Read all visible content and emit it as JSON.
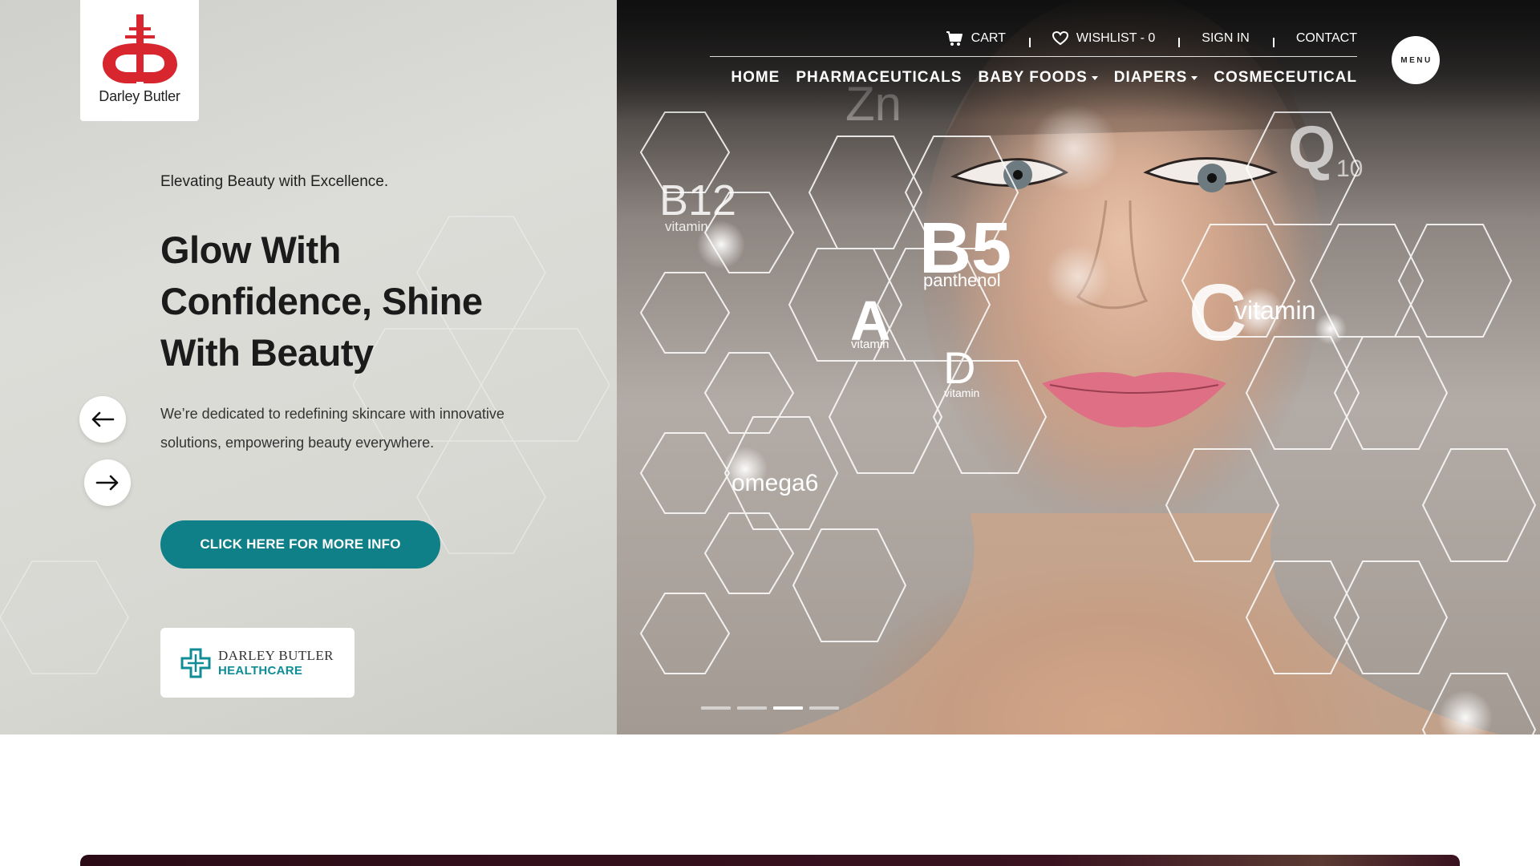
{
  "brand": {
    "name": "Darley Butler",
    "logo_color": "#d8262e"
  },
  "topbar": {
    "cart_label": "CART",
    "wishlist_label": "WISHLIST - 0",
    "signin_label": "SIGN IN",
    "contact_label": "CONTACT"
  },
  "nav": {
    "items": [
      {
        "label": "HOME",
        "dropdown": false
      },
      {
        "label": "PHARMACEUTICALS",
        "dropdown": false
      },
      {
        "label": "BABY FOODS",
        "dropdown": true
      },
      {
        "label": "DIAPERS",
        "dropdown": true
      },
      {
        "label": "COSMECEUTICAL",
        "dropdown": false
      }
    ],
    "menu_label": "MENU"
  },
  "hero": {
    "tagline": "Elevating Beauty with Excellence.",
    "headline": "Glow With Confidence, Shine With Beauty",
    "description": "We’re dedicated to redefining skincare with innovative solutions, empowering beauty everywhere.",
    "cta_label": "CLICK HERE FOR MORE INFO",
    "accent_color": "#0f8088",
    "slides_total": 4,
    "active_slide": 3,
    "image_labels": {
      "b12": "B12",
      "b12_sub": "vitamin",
      "b5": "B5",
      "b5_sub": "panthenol",
      "a": "A",
      "a_sub": "vitamin",
      "d": "D",
      "d_sub": "vitamin",
      "c_letter": "C",
      "c_word": "vitamin",
      "omega": "omega6",
      "q": "Q",
      "q_sub": "10",
      "zn": "Zn"
    }
  },
  "partner": {
    "line1": "DARLEY BUTLER",
    "line2": "HEALTHCARE",
    "color": "#0f8c94"
  },
  "icons": [
    "cart-icon",
    "heart-icon",
    "arrow-left-icon",
    "arrow-right-icon",
    "brand-logo-icon",
    "healthcare-cross-icon"
  ]
}
